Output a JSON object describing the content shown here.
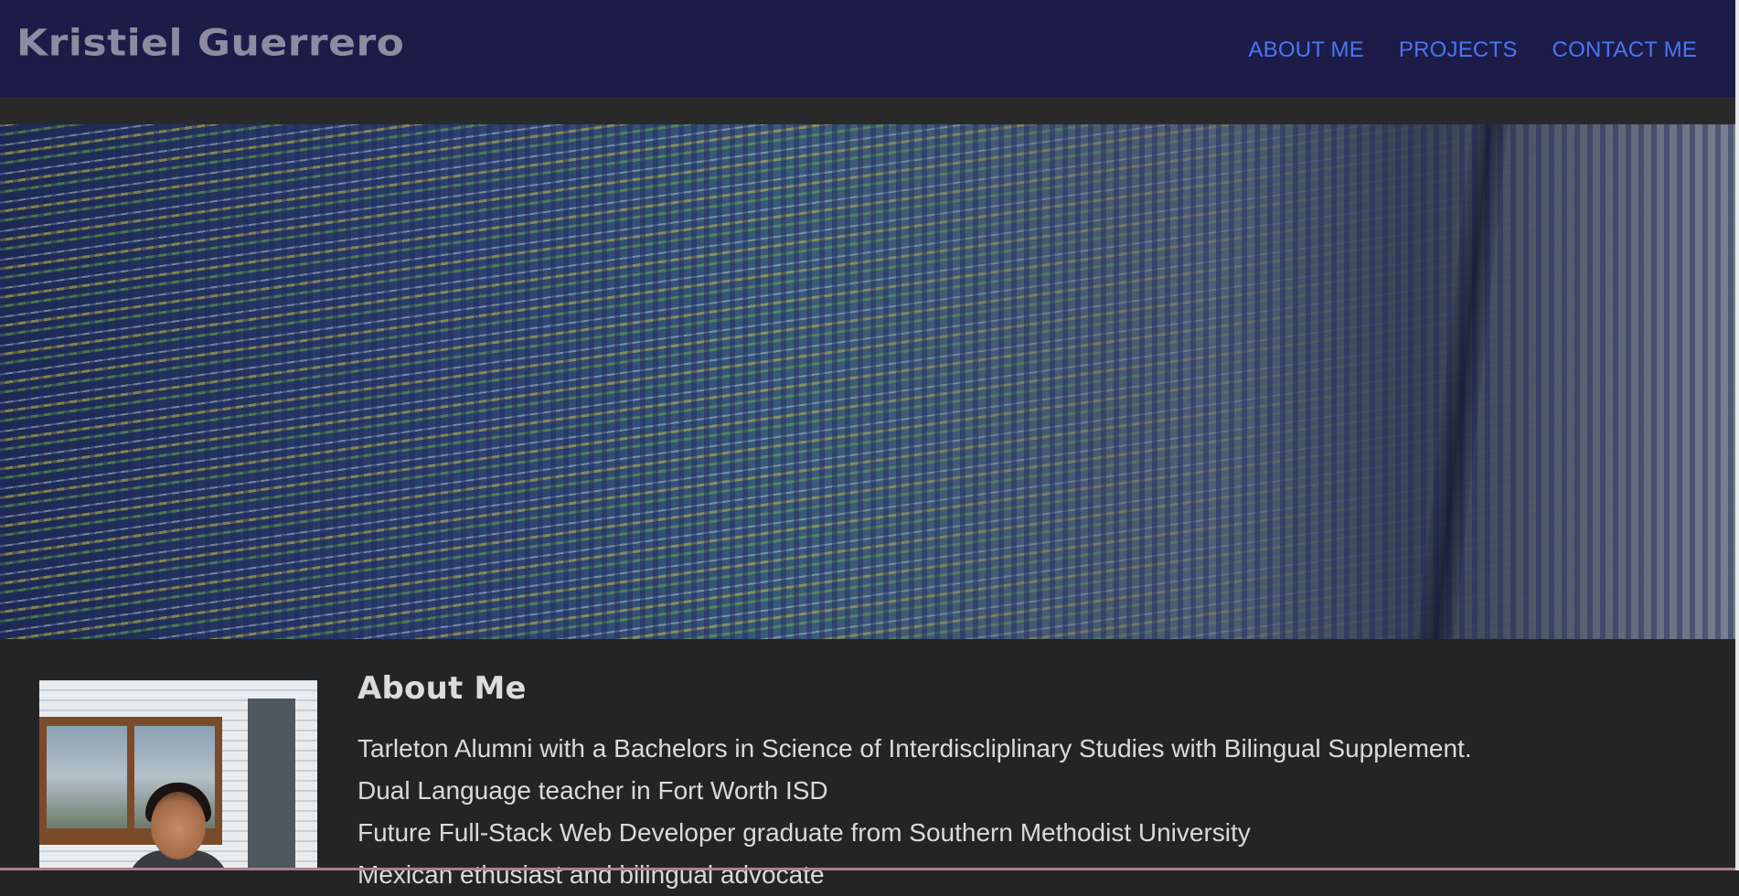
{
  "site": {
    "brand": "Kristiel Guerrero"
  },
  "nav": {
    "items": [
      {
        "label": "ABOUT ME"
      },
      {
        "label": "PROJECTS"
      },
      {
        "label": "CONTACT ME"
      }
    ]
  },
  "hero": {
    "image": "code-on-monitor-image"
  },
  "about": {
    "title": "About Me",
    "photo": "profile-photo",
    "lines": [
      "Tarleton Alumni with a Bachelors in Science of Interdiscliplinary Studies with Bilingual Supplement.",
      "Dual Language teacher in Fort Worth ISD",
      "Future Full-Stack Web Developer graduate from Southern Methodist University",
      "Mexican ethusiast and bilingual advocate"
    ]
  },
  "colors": {
    "header_bg": "#1d1b47",
    "brand_text": "#8d8ba0",
    "nav_link": "#4a76f2",
    "page_bg": "#252425",
    "body_text": "#dcdad6"
  }
}
